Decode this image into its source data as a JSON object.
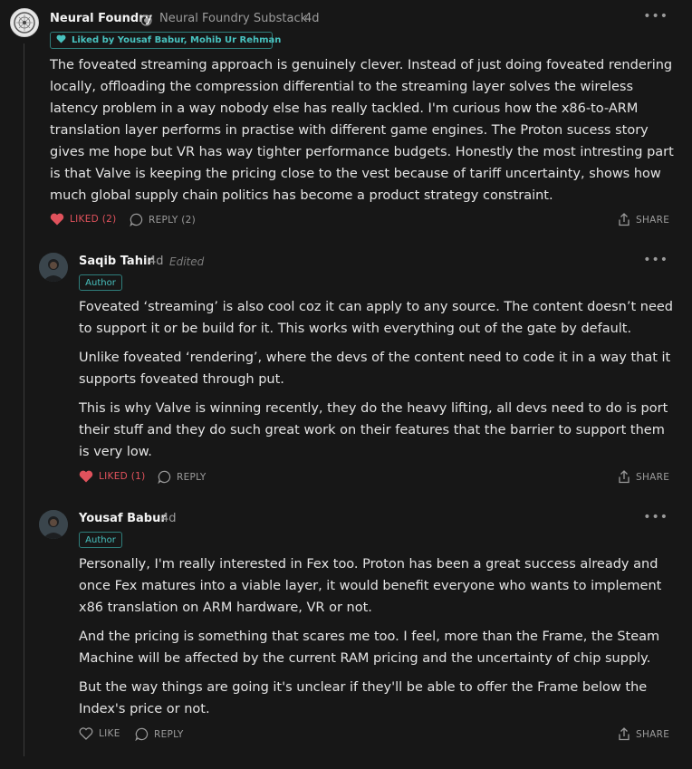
{
  "comments": [
    {
      "author": "Neural Foundry",
      "publication": "Neural Foundry Substack",
      "time": "4d",
      "liked_by": "Liked by Yousaf Babur, Mohib Ur Rehman",
      "paragraphs": [
        "The foveated streaming approach is genuinely clever. Instead of just doing foveated rendering locally, offloading the compression differential to the streaming layer solves the wireless latency problem in a way nobody else has really tackled. I'm curious how the x86-to-ARM translation layer performs in practise with different game engines. The Proton sucess story gives me hope but VR has way tighter performance budgets. Honestly the most intresting part is that Valve is keeping the pricing close to the vest because of tariff uncertainty, shows how much global supply chain politics has become a product strategy constraint."
      ],
      "like_label": "LIKED (2)",
      "reply_label": "REPLY (2)",
      "share_label": "SHARE"
    },
    {
      "author": "Saqib Tahir",
      "time": "4d",
      "edited": "Edited",
      "badge": "Author",
      "paragraphs": [
        "Foveated ‘streaming’ is also cool coz it can apply to any source. The content doesn’t need to support it or be build for it. This works with everything out of the gate by default.",
        "Unlike foveated ‘rendering’, where the devs of the content need to code it in a way that it supports foveated through put.",
        "This is why Valve is winning recently, they do the heavy lifting, all devs need to do is port their stuff and they do such great work on their features that the barrier to support them is very low."
      ],
      "like_label": "LIKED (1)",
      "reply_label": "REPLY",
      "share_label": "SHARE"
    },
    {
      "author": "Yousaf Babur",
      "time": "4d",
      "badge": "Author",
      "paragraphs": [
        "Personally, I'm really interested in Fex too. Proton has been a great success already and once Fex matures into a viable layer, it would benefit everyone who wants to implement x86 translation on ARM hardware, VR or not.",
        "And the pricing is something that scares me too. I feel, more than the Frame, the Steam Machine will be affected by the current RAM pricing and the uncertainty of chip supply.",
        "But the way things are going it's unclear if they'll be able to offer the Frame below the Index's price or not."
      ],
      "like_label": "LIKE",
      "reply_label": "REPLY",
      "share_label": "SHARE"
    }
  ],
  "icons": {
    "more": "more-icon",
    "heart": "heart-icon",
    "reply": "reply-icon",
    "share": "share-icon",
    "verified": "verified-icon"
  },
  "colors": {
    "accent": "#48c2bf",
    "liked": "#e0525c",
    "background": "#171717"
  }
}
